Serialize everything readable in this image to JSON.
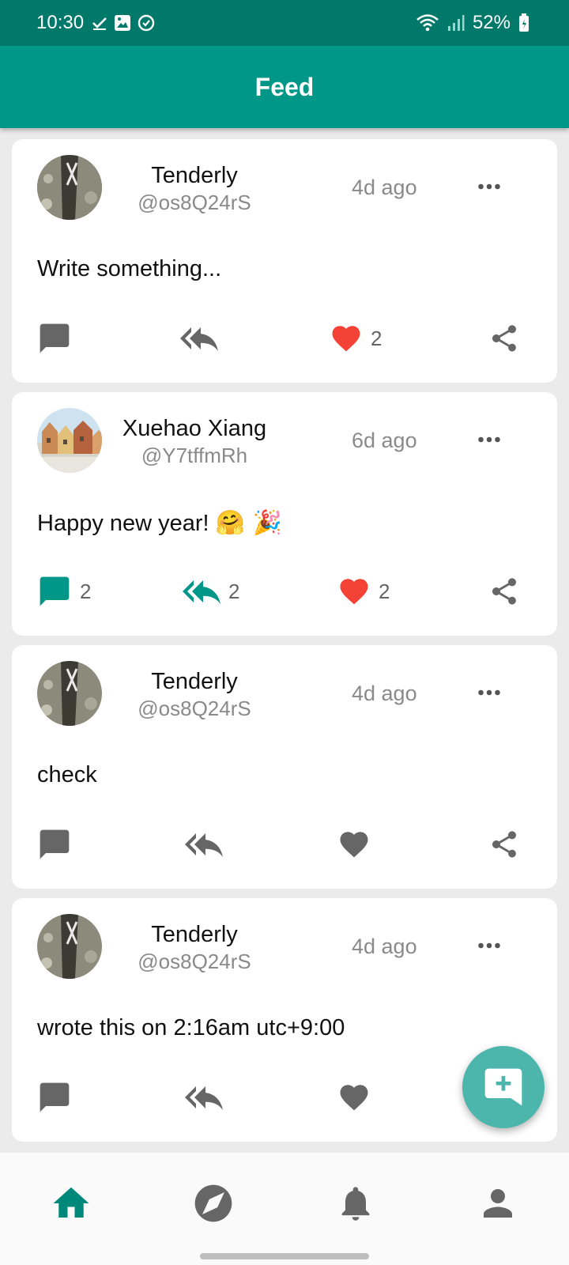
{
  "status_bar": {
    "time": "10:30",
    "battery": "52%"
  },
  "app_bar": {
    "title": "Feed"
  },
  "posts": [
    {
      "display_name": "Tenderly",
      "handle": "@os8Q24rS",
      "time": "4d ago",
      "text": "Write something...",
      "emoji": "",
      "comments": "",
      "reposts": "",
      "likes": "2",
      "liked": true
    },
    {
      "display_name": "Xuehao Xiang",
      "handle": "@Y7tffmRh",
      "time": "6d ago",
      "text": "Happy new year! ",
      "emoji": "🤗 🎉",
      "comments": "2",
      "reposts": "2",
      "likes": "2",
      "liked": true
    },
    {
      "display_name": "Tenderly",
      "handle": "@os8Q24rS",
      "time": "4d ago",
      "text": "check",
      "emoji": "",
      "comments": "",
      "reposts": "",
      "likes": "",
      "liked": false
    },
    {
      "display_name": "Tenderly",
      "handle": "@os8Q24rS",
      "time": "4d ago",
      "text": "wrote this on 2:16am utc+9:00",
      "emoji": "",
      "comments": "",
      "reposts": "",
      "likes": "",
      "liked": false
    }
  ],
  "icons": {
    "comment": "comment-icon",
    "repost": "reply-all-icon",
    "like": "heart-icon",
    "share": "share-icon",
    "more": "more-horizontal-icon",
    "fab": "add-comment-icon",
    "nav": [
      "home-icon",
      "explore-icon",
      "notifications-icon",
      "profile-icon"
    ]
  },
  "colors": {
    "primary": "#009688",
    "primary_dark": "#00796b",
    "accent": "#4db6ac",
    "like_active": "#f44336",
    "icon_inactive": "#666666"
  }
}
